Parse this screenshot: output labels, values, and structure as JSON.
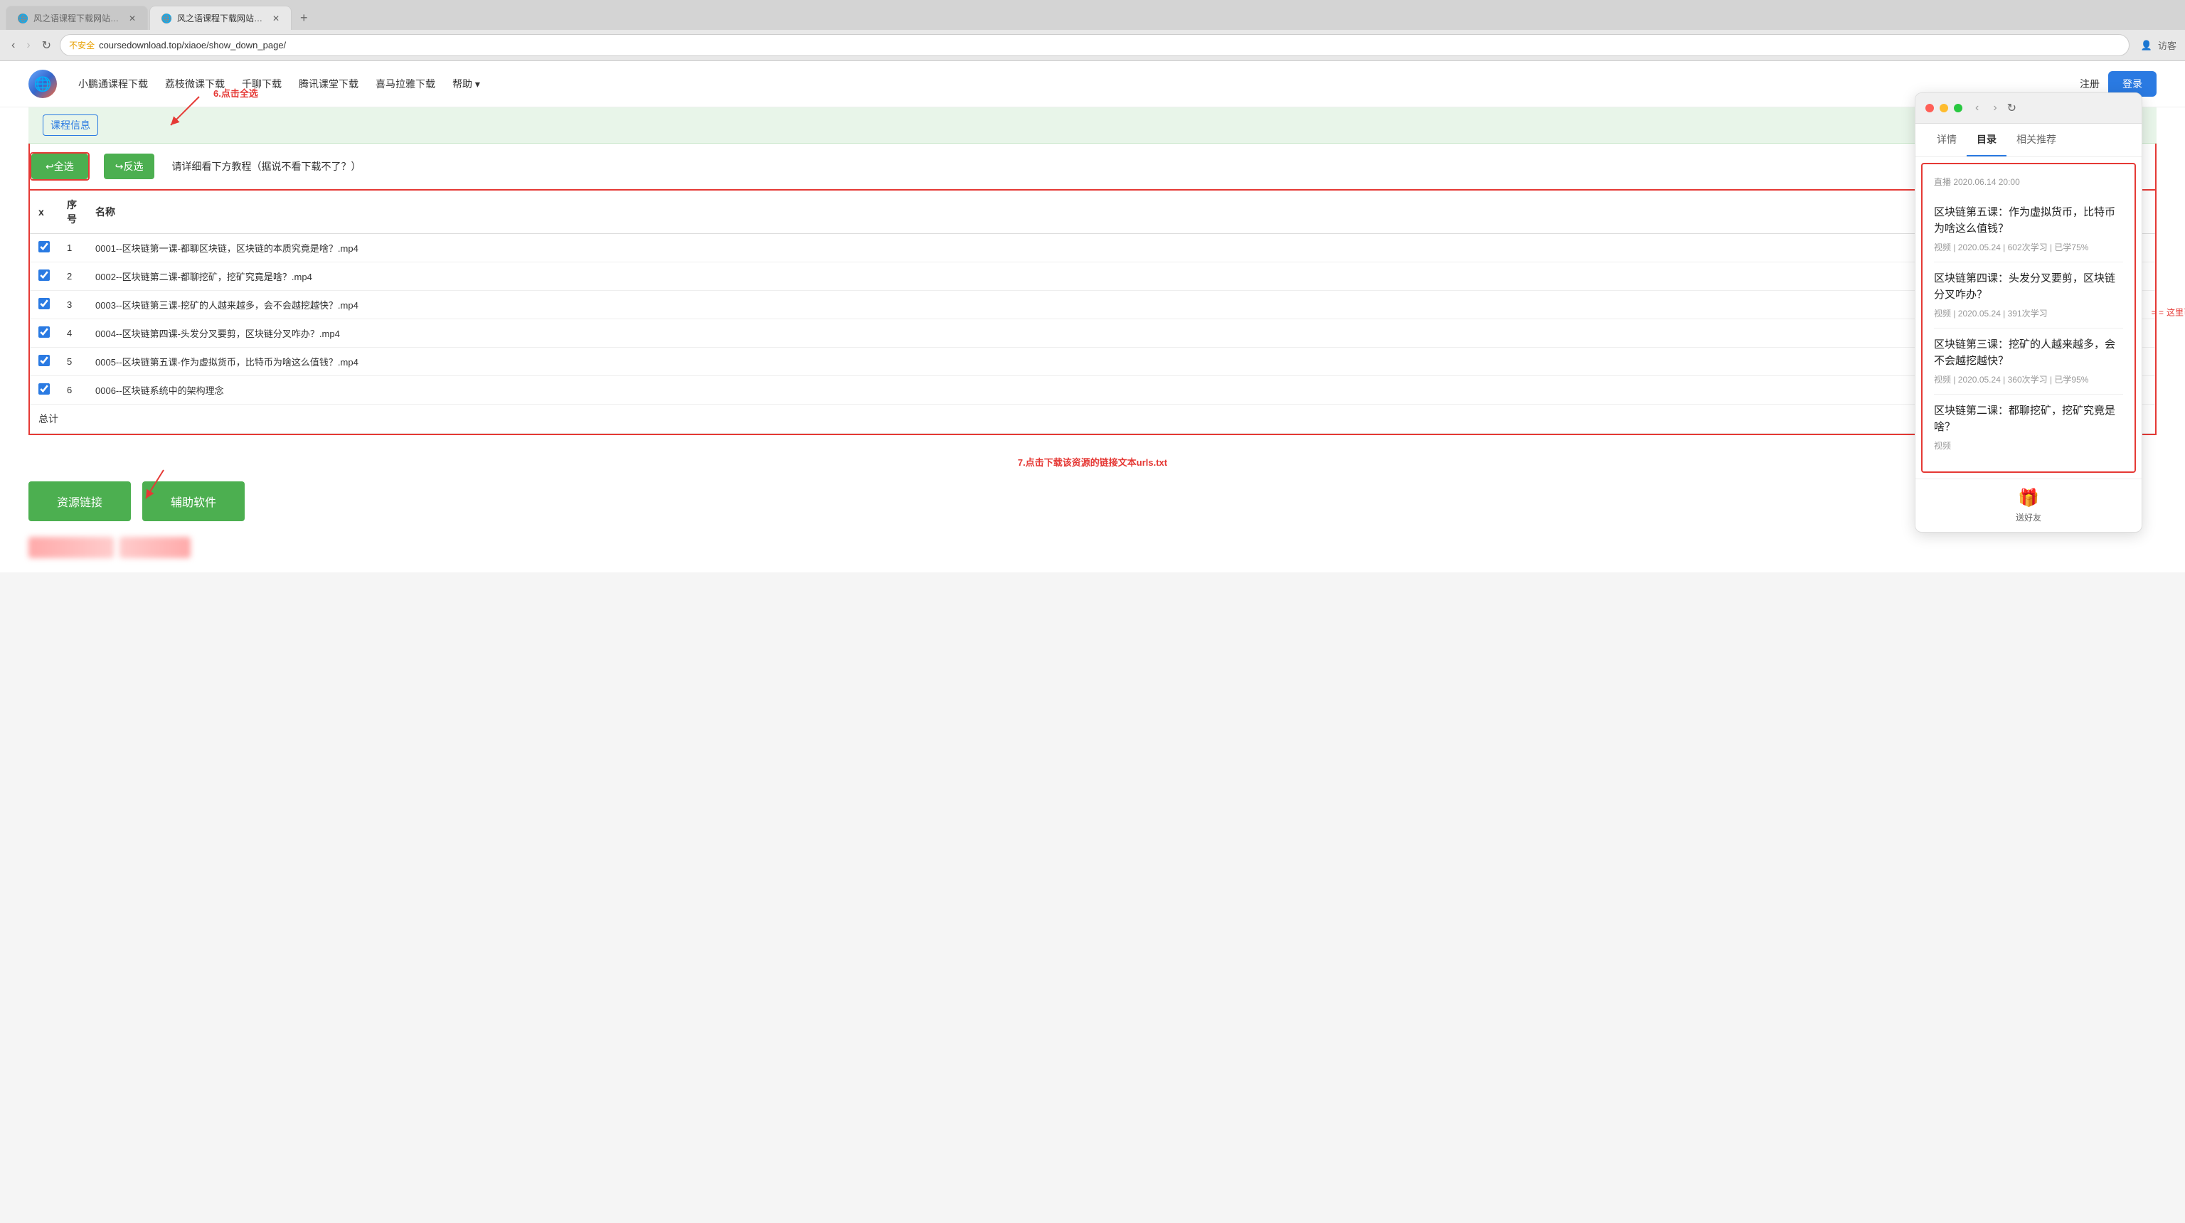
{
  "browser": {
    "tabs": [
      {
        "id": 1,
        "title": "风之语课程下载网站|小鹏通课程下载",
        "active": false,
        "favicon": "🌐"
      },
      {
        "id": 2,
        "title": "风之语课程下载网站|小鹏通课",
        "active": true,
        "favicon": "🌐"
      }
    ],
    "new_tab_label": "+",
    "address_bar": {
      "security": "不安全",
      "url": "coursedownload.top/xiaoe/show_down_page/"
    },
    "user_label": "访客",
    "nav": {
      "back_disabled": false,
      "forward_disabled": true
    }
  },
  "site": {
    "logo_emoji": "🌐",
    "nav_items": [
      "小鹏通课程下载",
      "荔枝微课下载",
      "千聊下载",
      "腾讯课堂下载",
      "喜马拉雅下载",
      "帮助 ▾"
    ],
    "auth": {
      "register": "注册",
      "login": "登录"
    }
  },
  "main": {
    "section_label": "课程信息",
    "step6_label": "6.点击全选",
    "btn_select_all": "↩全选",
    "btn_invert": "↪反选",
    "instruction": "请详细看下方教程（据说不看下载不了？）",
    "columns": {
      "x": "x",
      "num": "序号",
      "name": "名称"
    },
    "rows": [
      {
        "num": 1,
        "name": "0001--区块链第一课-都聊区块链，区块链的本质究竟是啥？.mp4",
        "checked": true
      },
      {
        "num": 2,
        "name": "0002--区块链第二课-都聊挖矿，挖矿究竟是啥？.mp4",
        "checked": true
      },
      {
        "num": 3,
        "name": "0003--区块链第三课-挖矿的人越来越多，会不会越挖越快？.mp4",
        "checked": true
      },
      {
        "num": 4,
        "name": "0004--区块链第四课-头发分叉要剪，区块链分叉咋办？.mp4",
        "checked": true
      },
      {
        "num": 5,
        "name": "0005--区块链第五课-作为虚拟货币，比特币为啥这么值钱？.mp4",
        "checked": true
      },
      {
        "num": 6,
        "name": "0006--区块链系统中的架构理念",
        "checked": true
      }
    ],
    "total_label": "总计",
    "annotation_right": "这里可以看出解析完全正确",
    "step7_label": "7.点击下载该资源的链接文本urls.txt",
    "btn_resource": "资源链接",
    "btn_assist": "辅助软件"
  },
  "panel": {
    "tabs": [
      "详情",
      "目录",
      "相关推荐"
    ],
    "active_tab": "目录",
    "live_meta": "直播 2020.06.14 20:00",
    "courses": [
      {
        "title": "区块链第五课：作为虚拟货币，比特币为啥这么值钱？",
        "type": "视频",
        "date": "2020.05.24",
        "views": "602次学习",
        "progress": "已学75%"
      },
      {
        "title": "区块链第四课：头发分叉要剪，区块链分叉咋办？",
        "type": "视频",
        "date": "2020.05.24",
        "views": "391次学习",
        "progress": ""
      },
      {
        "title": "区块链第三课：挖矿的人越来越多，会不会越挖越快？",
        "type": "视频",
        "date": "2020.05.24",
        "views": "360次学习",
        "progress": "已学95%"
      },
      {
        "title": "区块链第二课：都聊挖矿，挖矿究竟是啥？",
        "type": "视频",
        "date": "",
        "views": "",
        "progress": ""
      }
    ],
    "footer": {
      "icon": "🎁",
      "text": "送好友"
    }
  }
}
